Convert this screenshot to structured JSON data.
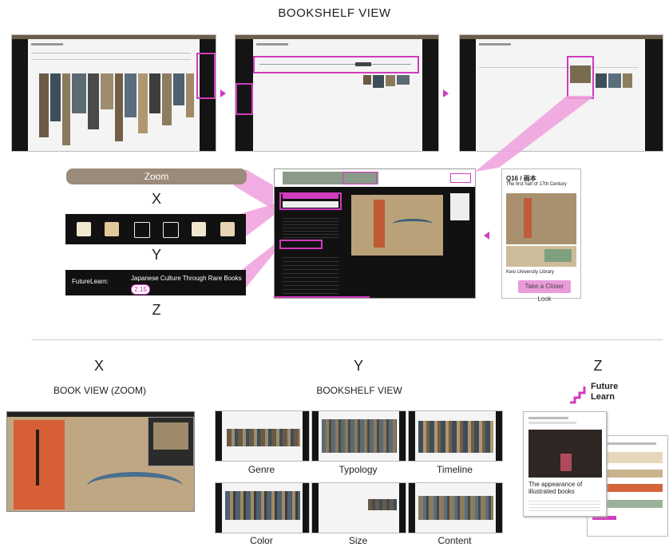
{
  "heading": "BOOKSHELF VIEW",
  "left_menu": {
    "zoom_label": "Zoom",
    "x_letter": "X",
    "y_letter": "Y",
    "z_letter": "Z",
    "futurelearn_label": "FutureLearn:",
    "course_title": "Japanese Culture Through Rare Books",
    "step_badge": "2.15"
  },
  "detail_card": {
    "book_id": "Q16 / 画本",
    "period": "The first half of 17th Century",
    "library": "Keio University Library",
    "button": "Take a Closer Look"
  },
  "bottom": {
    "x_letter": "X",
    "y_letter": "Y",
    "z_letter": "Z",
    "book_view_label": "BOOK VIEW (ZOOM)",
    "bookshelf_label": "BOOKSHELF VIEW",
    "futurelearn_logo_line1": "Future",
    "futurelearn_logo_line2": "Learn",
    "grid_labels": [
      "Genre",
      "Typology",
      "Timeline",
      "Color",
      "Size",
      "Content"
    ],
    "article_title": "The appearance of illustrated books"
  },
  "colors": {
    "highlight": "#d13bbd",
    "funnel": "#ee9fdc",
    "zoom_pill": "#9b8b7a",
    "dark": "#111111"
  }
}
